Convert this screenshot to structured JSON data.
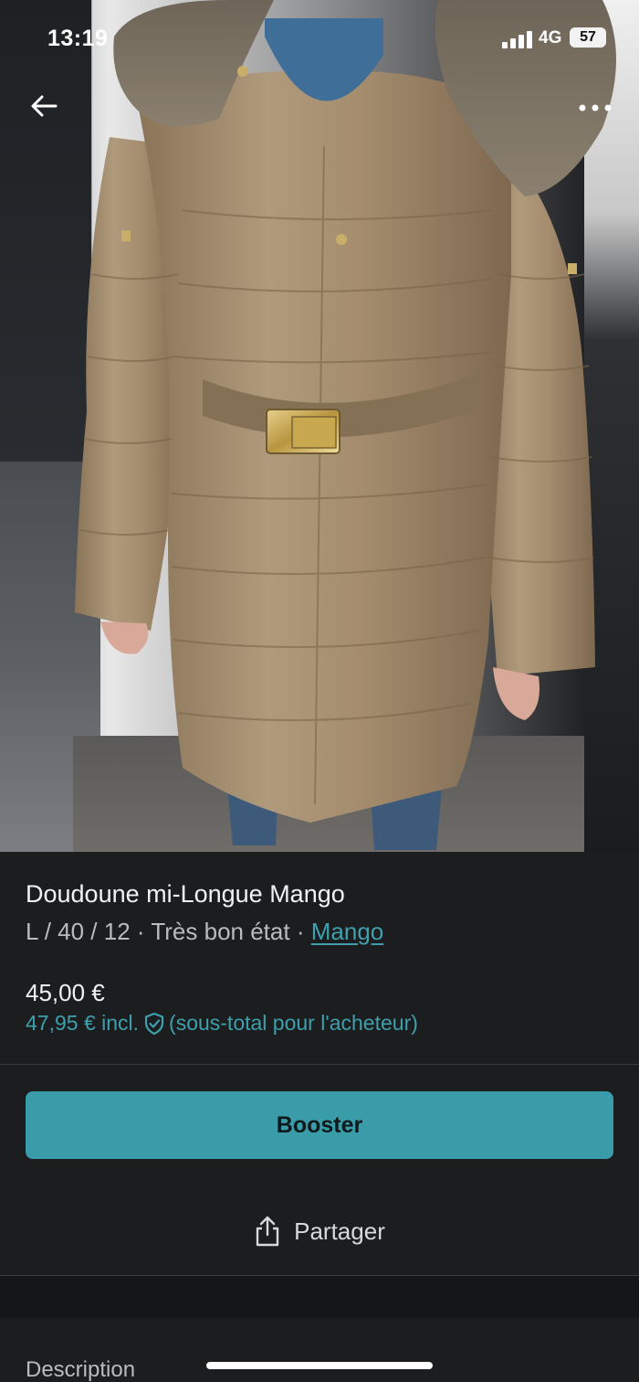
{
  "status_bar": {
    "time": "13:19",
    "network": "4G",
    "battery": "57"
  },
  "nav": {
    "back_icon": "arrow-left-icon",
    "more_icon": "more-dots-icon"
  },
  "listing": {
    "title": "Doudoune mi-Longue Mango",
    "size": "L / 40 / 12",
    "separator": "·",
    "condition": "Très bon état",
    "brand": "Mango",
    "price": "45,00 €",
    "price_incl": "47,95 € incl.",
    "price_incl_note": "(sous-total pour l'acheteur)"
  },
  "actions": {
    "booster_label": "Booster",
    "share_label": "Partager",
    "share_icon": "share-icon"
  },
  "sections": {
    "description_heading": "Description"
  },
  "colors": {
    "accent": "#3a9ca9",
    "link": "#3ea0ad",
    "background": "#1b1d1f"
  }
}
